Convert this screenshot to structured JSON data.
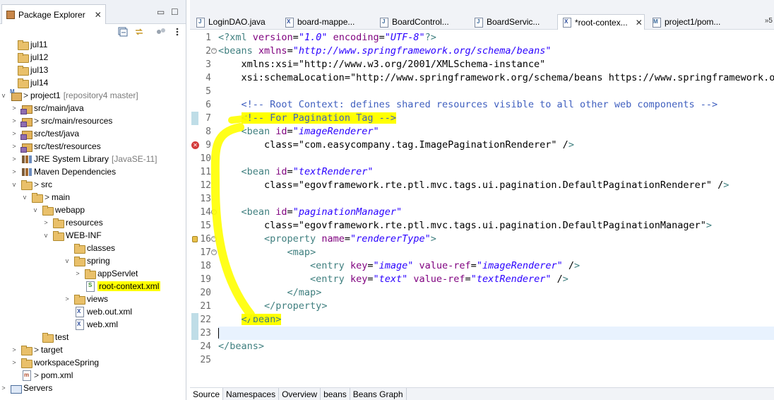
{
  "explorer": {
    "tab_label": "Package Explorer",
    "tree": [
      {
        "label": "jul11",
        "icon": "folder-icon",
        "twisty": ""
      },
      {
        "label": "jul12",
        "icon": "folder-icon",
        "twisty": ""
      },
      {
        "label": "jul13",
        "icon": "folder-icon",
        "twisty": ""
      },
      {
        "label": "jul14",
        "icon": "folder-icon",
        "twisty": ""
      },
      {
        "label": "project1",
        "prefix": ">",
        "decoration": "[repository4 master]",
        "icon": "maven-project-icon",
        "twisty": "v"
      },
      {
        "label": "src/main/java",
        "icon": "source-folder-icon",
        "twisty": ">"
      },
      {
        "label": "src/main/resources",
        "prefix": ">",
        "icon": "source-folder-icon",
        "twisty": ">"
      },
      {
        "label": "src/test/java",
        "icon": "source-folder-icon",
        "twisty": ">"
      },
      {
        "label": "src/test/resources",
        "icon": "source-folder-icon",
        "twisty": ">"
      },
      {
        "label": "JRE System Library",
        "decoration": "[JavaSE-11]",
        "icon": "library-icon",
        "twisty": ">"
      },
      {
        "label": "Maven Dependencies",
        "icon": "library-icon",
        "twisty": ">"
      },
      {
        "label": "src",
        "prefix": ">",
        "icon": "folder-icon",
        "twisty": "v"
      },
      {
        "label": "main",
        "prefix": ">",
        "icon": "folder-icon",
        "twisty": "v"
      },
      {
        "label": "webapp",
        "icon": "folder-icon",
        "twisty": "v"
      },
      {
        "label": "resources",
        "icon": "folder-icon",
        "twisty": ">"
      },
      {
        "label": "WEB-INF",
        "icon": "folder-icon",
        "twisty": "v"
      },
      {
        "label": "classes",
        "icon": "folder-icon",
        "twisty": ""
      },
      {
        "label": "spring",
        "icon": "folder-icon",
        "twisty": "v"
      },
      {
        "label": "appServlet",
        "icon": "folder-icon",
        "twisty": ">"
      },
      {
        "label": "root-context.xml",
        "icon": "spring-xml-icon",
        "twisty": ""
      },
      {
        "label": "views",
        "icon": "folder-icon",
        "twisty": ">"
      },
      {
        "label": "web.out.xml",
        "icon": "xml-file-icon",
        "twisty": ""
      },
      {
        "label": "web.xml",
        "icon": "xml-file-icon",
        "twisty": ""
      },
      {
        "label": "test",
        "icon": "folder-icon",
        "twisty": ""
      },
      {
        "label": "target",
        "prefix": ">",
        "icon": "folder-icon",
        "twisty": ">"
      },
      {
        "label": "workspaceSpring",
        "icon": "folder-icon",
        "twisty": ">"
      },
      {
        "label": "pom.xml",
        "prefix": ">",
        "icon": "pom-xml-icon",
        "twisty": ""
      },
      {
        "label": "Servers",
        "icon": "servers-icon",
        "twisty": ">"
      }
    ]
  },
  "editor": {
    "tabs": [
      {
        "label": "LoginDAO.java",
        "icon": "java-file-icon"
      },
      {
        "label": "board-mappe...",
        "icon": "xml-file-icon"
      },
      {
        "label": "BoardControl...",
        "icon": "java-file-icon"
      },
      {
        "label": "BoardServic...",
        "icon": "java-file-icon"
      },
      {
        "label": "*root-contex...",
        "icon": "xml-file-icon"
      },
      {
        "label": "project1/pom...",
        "icon": "maven-file-icon"
      }
    ],
    "active_tab": 4,
    "overflow_label": "»5",
    "current_line": 23,
    "highlighted_line": 7,
    "error_line": 9,
    "warning_line": 16,
    "lines": [
      "<?xml version=\"1.0\" encoding=\"UTF-8\"?>",
      "<beans xmlns=\"http://www.springframework.org/schema/beans\"",
      "    xmlns:xsi=\"http://www.w3.org/2001/XMLSchema-instance\"",
      "    xsi:schemaLocation=\"http://www.springframework.org/schema/beans https://www.springframework.o",
      "",
      "    <!-- Root Context: defines shared resources visible to all other web components -->",
      "    <!-- For Pagination Tag -->",
      "    <bean id=\"imageRenderer\"",
      "        class=\"com.easycompany.tag.ImagePaginationRenderer\" />",
      "",
      "    <bean id=\"textRenderer\"",
      "        class=\"egovframework.rte.ptl.mvc.tags.ui.pagination.DefaultPaginationRenderer\" />",
      "",
      "    <bean id=\"paginationManager\"",
      "        class=\"egovframework.rte.ptl.mvc.tags.ui.pagination.DefaultPaginationManager\">",
      "        <property name=\"rendererType\">",
      "            <map>",
      "                <entry key=\"image\" value-ref=\"imageRenderer\" />",
      "                <entry key=\"text\" value-ref=\"textRenderer\" />",
      "            </map>",
      "        </property>",
      "    </bean>",
      "",
      "</beans>",
      ""
    ],
    "bottom_tabs": [
      "Source",
      "Namespaces",
      "Overview",
      "beans",
      "Beans Graph"
    ]
  }
}
